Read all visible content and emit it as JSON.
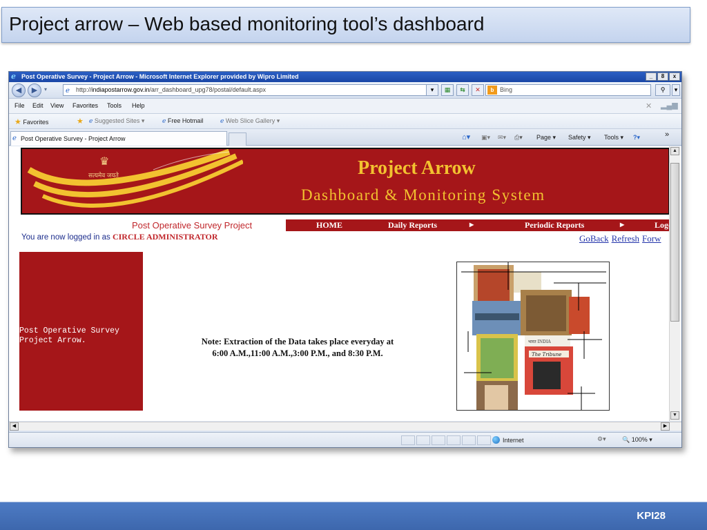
{
  "slide": {
    "title": "Project arrow – Web based monitoring tool’s dashboard",
    "footer_label": "KPI28",
    "colors": {
      "title_bg": "#c4d4ee",
      "footer_bg": "#4572b8"
    }
  },
  "browser": {
    "window_title": "Post Operative Survey - Project Arrow - Microsoft Internet Explorer provided by Wipro Limited",
    "window_buttons": [
      "_",
      "8",
      "x"
    ],
    "address": {
      "prefix": "http://",
      "domain": "indiapostarrow.gov.in",
      "path": "/arr_dashboard_upg78/postal/default.aspx"
    },
    "search": {
      "engine": "Bing"
    },
    "menu": [
      "File",
      "Edit",
      "View",
      "Favorites",
      "Tools",
      "Help"
    ],
    "favorites_bar": {
      "favorites_label": "Favorites",
      "items": [
        "Suggested Sites ▾",
        "Free Hotmail",
        "Web Slice Gallery ▾"
      ]
    },
    "tab_title": "Post Operative Survey - Project Arrow",
    "command_bar": [
      "Page ▾",
      "Safety ▾",
      "Tools ▾"
    ],
    "status": {
      "zone": "Internet",
      "zoom": "100%"
    }
  },
  "site": {
    "banner": {
      "motto": "सत्यमेव जयते",
      "title": "Project Arrow",
      "subtitle": "Dashboard & Monitoring System"
    },
    "project_label": "Post Operative Survey Project",
    "nav": {
      "home": "HOME",
      "daily": "Daily Reports",
      "periodic": "Periodic Reports",
      "logout": "Logo"
    },
    "logged_in_prefix": "You are now logged in as",
    "role": "CIRCLE ADMINISTRATOR",
    "links": {
      "goback": "GoBack",
      "refresh": "Refresh",
      "forward": "Forw"
    },
    "side_panel": {
      "line1": "Post Operative Survey",
      "line2": "Project Arrow."
    },
    "note": "Note: Extraction of the Data takes place everyday at 6:00 A.M.,11:00 A.M.,3:00 P.M., and 8:30 P.M.",
    "stamp_texts": {
      "india": "भारत INDIA",
      "tribune": "The Tribune"
    },
    "colors": {
      "brand_red": "#a51619",
      "gold": "#f2c230",
      "link_blue": "#2233aa"
    }
  }
}
